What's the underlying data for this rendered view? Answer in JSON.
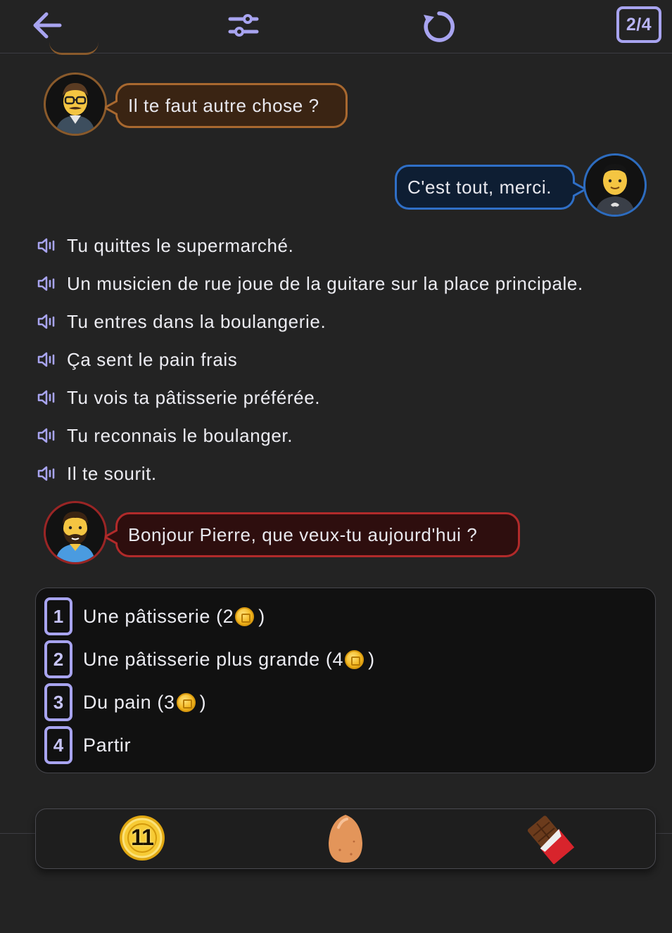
{
  "header": {
    "back_icon": "arrow-left-icon",
    "settings_icon": "sliders-icon",
    "reload_icon": "reload-icon",
    "progress": "2/4",
    "accent_color": "#a8a4f0"
  },
  "dialogue": {
    "shopkeeper_line": "Il te faut autre chose ?",
    "player_line": "C'est tout, merci.",
    "baker_line": "Bonjour Pierre, que veux-tu aujourd'hui ?"
  },
  "narration": [
    "Tu quittes le supermarché.",
    "Un musicien de rue joue de la guitare sur la place principale.",
    "Tu entres dans la boulangerie.",
    "Ça sent le pain frais",
    "Tu vois ta pâtisserie préférée.",
    "Tu reconnais le boulanger.",
    "Il te sourit."
  ],
  "choices": [
    {
      "number": "1",
      "label": "Une pâtisserie (2",
      "close": ")",
      "coin_icon": "coin-icon"
    },
    {
      "number": "2",
      "label": "Une pâtisserie plus grande (4",
      "close": ")",
      "coin_icon": "coin-icon"
    },
    {
      "number": "3",
      "label": "Du pain (3",
      "close": ")",
      "coin_icon": "coin-icon"
    },
    {
      "number": "4",
      "label": "Partir"
    }
  ],
  "inventory": {
    "coins": "11",
    "items": [
      "coin-icon",
      "egg-icon",
      "chocolate-bar-icon"
    ]
  },
  "colors": {
    "background": "#232323",
    "shopkeeper_bubble_border": "#a8682f",
    "player_bubble_border": "#2f6fc7",
    "baker_bubble_border": "#b12a2a"
  }
}
